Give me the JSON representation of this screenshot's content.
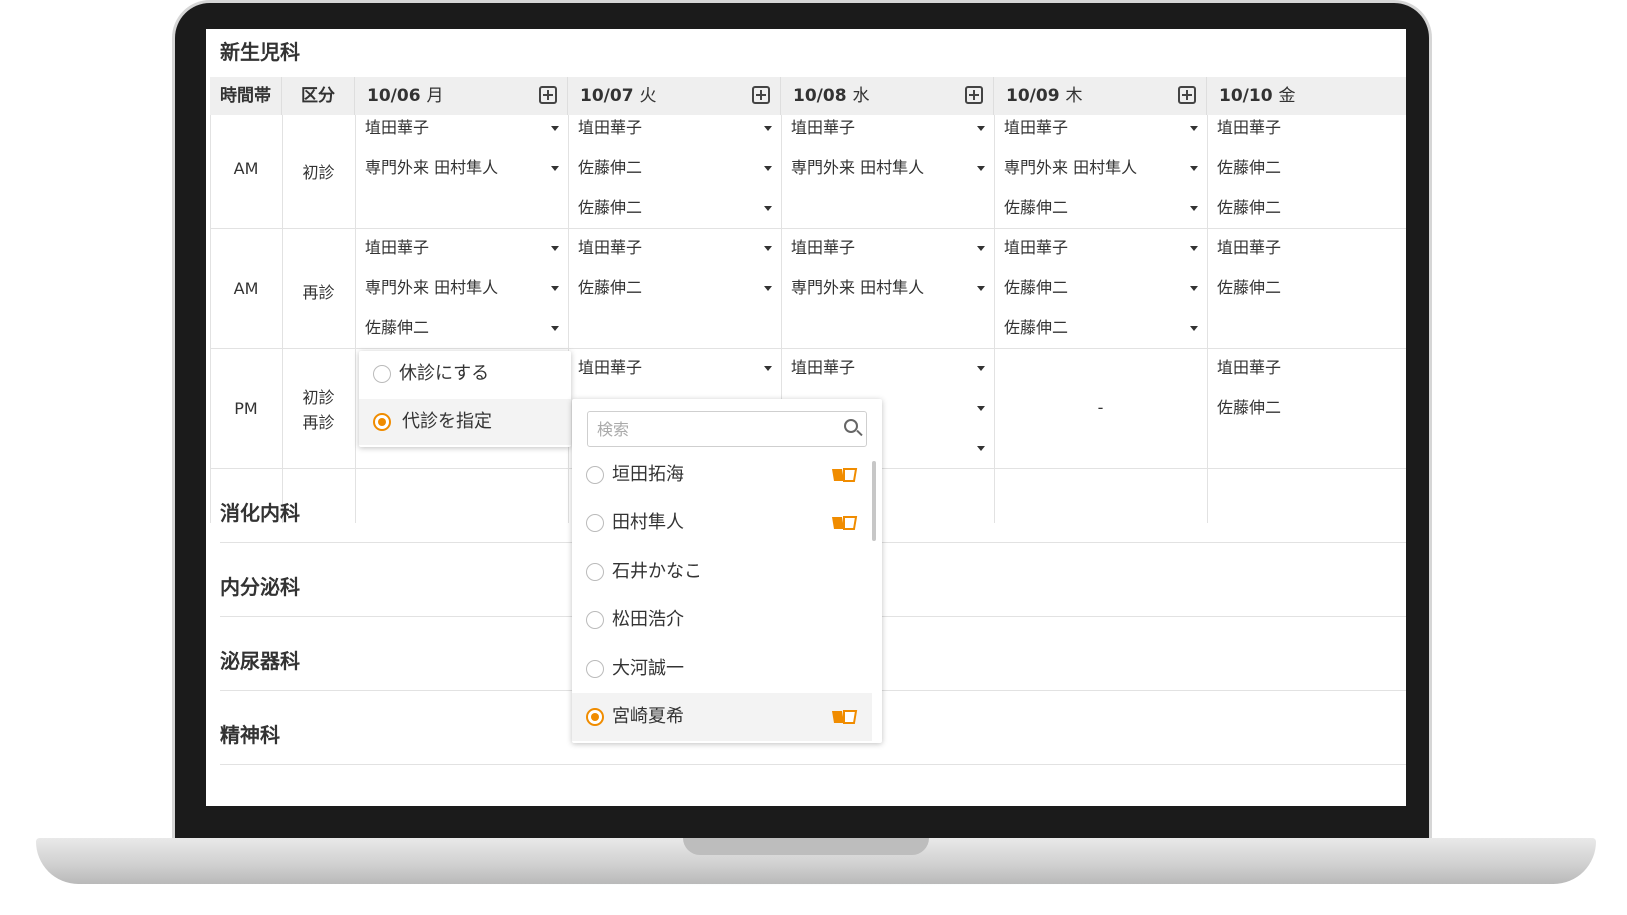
{
  "departments": {
    "d1": "新生児科",
    "d2": "消化内科",
    "d3": "内分泌科",
    "d4": "泌尿器科",
    "d5": "精神科"
  },
  "header": {
    "time": "時間帯",
    "type": "区分",
    "days": [
      "10/06",
      "10/07",
      "10/08",
      "10/09",
      "10/10"
    ],
    "weekdays": [
      "月",
      "火",
      "水",
      "木",
      "金"
    ]
  },
  "rows": [
    {
      "time": "AM",
      "type": "初診"
    },
    {
      "time": "AM",
      "type": "再診"
    },
    {
      "time": "PM",
      "type": "初診\n再診"
    }
  ],
  "cells": {
    "r0": {
      "c0": [
        "埴田華子",
        "専門外来 田村隼人"
      ],
      "c1": [
        "埴田華子",
        "佐藤伸二",
        "佐藤伸二"
      ],
      "c2": [
        "埴田華子",
        "専門外来 田村隼人"
      ],
      "c3": [
        "埴田華子",
        "専門外来 田村隼人",
        "佐藤伸二"
      ],
      "c4": [
        "埴田華子",
        "佐藤伸二",
        "佐藤伸二"
      ]
    },
    "r1": {
      "c0": [
        "埴田華子",
        "専門外来 田村隼人",
        "佐藤伸二"
      ],
      "c1": [
        "埴田華子",
        "佐藤伸二"
      ],
      "c2": [
        "埴田華子",
        "専門外来 田村隼人"
      ],
      "c3": [
        "埴田華子",
        "佐藤伸二",
        "佐藤伸二"
      ],
      "c4": [
        "埴田華子",
        "佐藤伸二"
      ]
    },
    "r2": {
      "c1": [
        "埴田華子"
      ],
      "c2": [
        "埴田華子"
      ],
      "c3": [
        "-"
      ],
      "c4": [
        "埴田華子",
        "佐藤伸二"
      ]
    }
  },
  "popup_options": {
    "option1": "休診にする",
    "option2": "代診を指定",
    "selected": "代診を指定"
  },
  "substitute": {
    "search_placeholder": "検索",
    "doctors": [
      "垣田拓海",
      "田村隼人",
      "石井かなこ",
      "松田浩介",
      "大河誠一",
      "宮崎夏希"
    ],
    "selected": "宮崎夏希",
    "book_marked": [
      "垣田拓海",
      "田村隼人",
      "宮崎夏希"
    ]
  },
  "colors": {
    "accent": "#f08c00",
    "header_bg": "#efefef",
    "grid_line": "#e2e2e2"
  }
}
